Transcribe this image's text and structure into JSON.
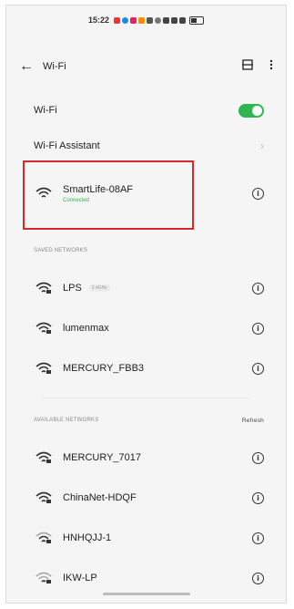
{
  "status_bar": {
    "time": "15:22"
  },
  "app_bar": {
    "title": "Wi-Fi"
  },
  "wifi_toggle": {
    "label": "Wi-Fi",
    "on": true
  },
  "assistant": {
    "label": "Wi-Fi Assistant"
  },
  "connected_network": {
    "name": "SmartLife-08AF",
    "status": "Connected"
  },
  "saved_networks": {
    "header": "SAVED NETWORKS",
    "items": [
      {
        "name": "LPS",
        "tag": "2.4GHz"
      },
      {
        "name": "lumenmax"
      },
      {
        "name": "MERCURY_FBB3"
      }
    ]
  },
  "available_networks": {
    "header": "AVAILABLE NETWORKS",
    "refresh": "Refresh",
    "items": [
      {
        "name": "MERCURY_7017"
      },
      {
        "name": "ChinaNet-HDQF"
      },
      {
        "name": "HNHQJJ-1"
      },
      {
        "name": "IKW-LP"
      }
    ]
  },
  "colors": {
    "accent_green": "#2fb552",
    "highlight_red": "#d62a2a"
  }
}
